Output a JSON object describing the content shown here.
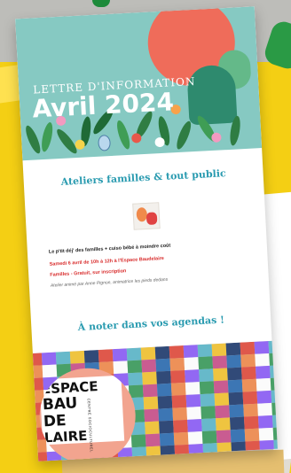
{
  "newsletter": {
    "hero": {
      "subtitle": "LETTRE D'INFORMATION",
      "title": "Avril 2024"
    },
    "section_ateliers": "Ateliers familles & tout public",
    "event": {
      "title": "Le p'tit déj' des familles + cuiso bébé à moindre coût",
      "date": "Samedi 6 avril de 10h à 12h à l'Espace Baudelaire",
      "price": "Familles - Gratuit, sur inscription",
      "note": "Atelier animé par Anne Pignon, animatrice les pieds dedans"
    },
    "section_agenda": "À noter dans vos agendas !",
    "logo": {
      "line1": "ESPACE",
      "line2": "BAU",
      "line3": "DE",
      "line4": "LAIRE",
      "small": "CENTRE SOCIOCULTUREL"
    }
  },
  "colors": {
    "background": "#f4cf14",
    "section_title": "#2a9bb0",
    "accent_red": "#d82b2b",
    "hero_sun": "#ef6c5a"
  }
}
